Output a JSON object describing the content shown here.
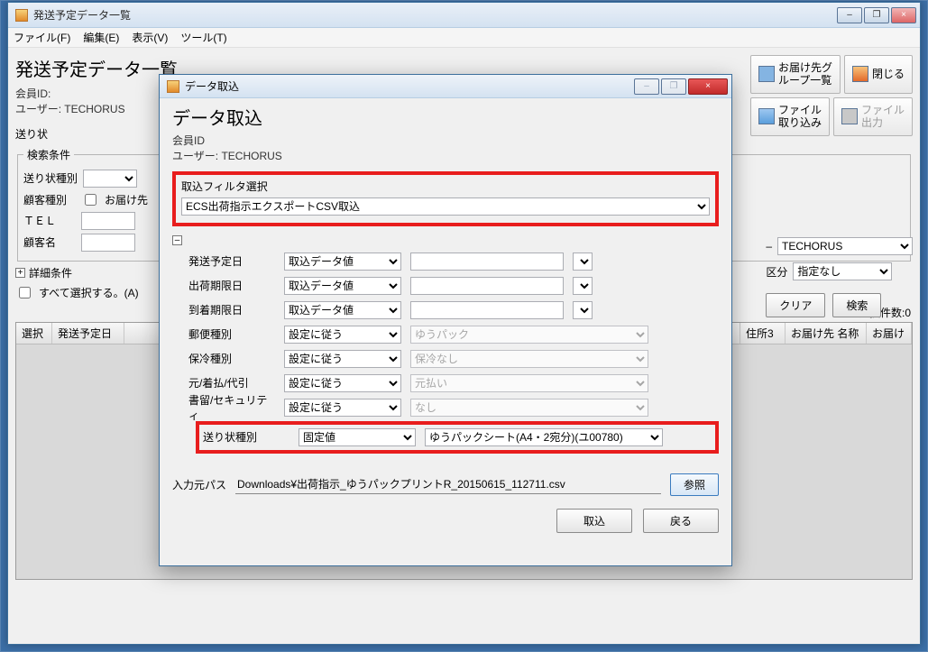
{
  "main_window": {
    "title": "発送予定データ一覧",
    "menu": {
      "file": "ファイル(F)",
      "edit": "編集(E)",
      "view": "表示(V)",
      "tool": "ツール(T)"
    },
    "heading": "発送予定データ一覧",
    "account_id_label": "会員ID:",
    "account_id_value": "",
    "user_label": "ユーザー:",
    "user_value": "TECHORUS",
    "okurijo_label": "送り状",
    "search_legend": "検索条件",
    "form": {
      "okurijo_type_label": "送り状種別",
      "customer_type_label": "顧客種別",
      "tel_label": "ＴＥＬ",
      "customer_name_label": "顧客名",
      "otodokesaki_checkbox_label": "お届け先"
    },
    "detail_conditions": "詳細条件",
    "select_all": "すべて選択する。(A)",
    "selected_count_label": "選択件数:",
    "selected_count_value": "0",
    "grid_headers": [
      "選択",
      "発送予定日",
      "住所3",
      "お届け先 名称",
      "お届け"
    ],
    "right_fields": {
      "techorus_select": "TECHORUS",
      "kubun_label": "区分",
      "kubun_select": "指定なし",
      "clear_btn": "クリア",
      "search_btn": "検索"
    },
    "toolbar": {
      "group_list": "お届け先グ\nループ一覧",
      "close": "閉じる",
      "file_import": "ファイル\n取り込み",
      "file_export": "ファイル\n出力"
    },
    "winbtn_min": "–",
    "winbtn_max": "❐",
    "winbtn_close": "×"
  },
  "modal": {
    "title": "データ取込",
    "heading": "データ取込",
    "account_id_label": "会員ID",
    "account_id_value": "",
    "user_label": "ユーザー:",
    "user_value": "TECHORUS",
    "filter_label": "取込フィルタ選択",
    "filter_value": "ECS出荷指示エクスポートCSV取込",
    "rows": [
      {
        "label": "発送予定日",
        "sel": "取込データ値",
        "txt": ""
      },
      {
        "label": "出荷期限日",
        "sel": "取込データ値",
        "txt": ""
      },
      {
        "label": "到着期限日",
        "sel": "取込データ値",
        "txt": ""
      },
      {
        "label": "郵便種別",
        "sel": "設定に従う",
        "txt": "ゆうパック"
      },
      {
        "label": "保冷種別",
        "sel": "設定に従う",
        "txt": "保冷なし"
      },
      {
        "label": "元/着払/代引",
        "sel": "設定に従う",
        "txt": "元払い"
      },
      {
        "label": "書留/セキュリティ",
        "sel": "設定に従う",
        "txt": "なし"
      },
      {
        "label": "送り状種別",
        "sel": "固定値",
        "txt": "ゆうパックシート(A4・2宛分)(ユ00780)"
      }
    ],
    "path_label": "入力元パス",
    "path_value": "Downloads¥出荷指示_ゆうパックプリントR_20150615_112711.csv",
    "browse_btn": "参照",
    "import_btn": "取込",
    "back_btn": "戻る",
    "winbtn_min": "–",
    "winbtn_max": "❐",
    "winbtn_close": "×"
  }
}
